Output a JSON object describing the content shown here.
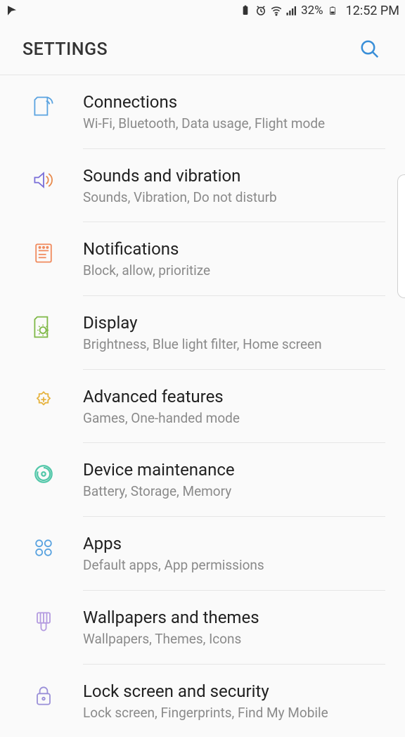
{
  "status": {
    "battery_text": "32%",
    "time": "12:52 PM"
  },
  "header": {
    "title": "SETTINGS"
  },
  "items": [
    {
      "title": "Connections",
      "sub": "Wi-Fi, Bluetooth, Data usage, Flight mode"
    },
    {
      "title": "Sounds and vibration",
      "sub": "Sounds, Vibration, Do not disturb"
    },
    {
      "title": "Notifications",
      "sub": "Block, allow, prioritize"
    },
    {
      "title": "Display",
      "sub": "Brightness, Blue light filter, Home screen"
    },
    {
      "title": "Advanced features",
      "sub": "Games, One-handed mode"
    },
    {
      "title": "Device maintenance",
      "sub": "Battery, Storage, Memory"
    },
    {
      "title": "Apps",
      "sub": "Default apps, App permissions"
    },
    {
      "title": "Wallpapers and themes",
      "sub": "Wallpapers, Themes, Icons"
    },
    {
      "title": "Lock screen and security",
      "sub": "Lock screen, Fingerprints, Find My Mobile"
    }
  ],
  "colors": {
    "accent_blue": "#3a8fd8",
    "icon_purple": "#7a6fd8",
    "icon_orange": "#f08a5d",
    "icon_green": "#7fb847",
    "icon_gold": "#e6b33e",
    "icon_teal": "#52c7a9",
    "icon_lilac": "#b49be0"
  }
}
